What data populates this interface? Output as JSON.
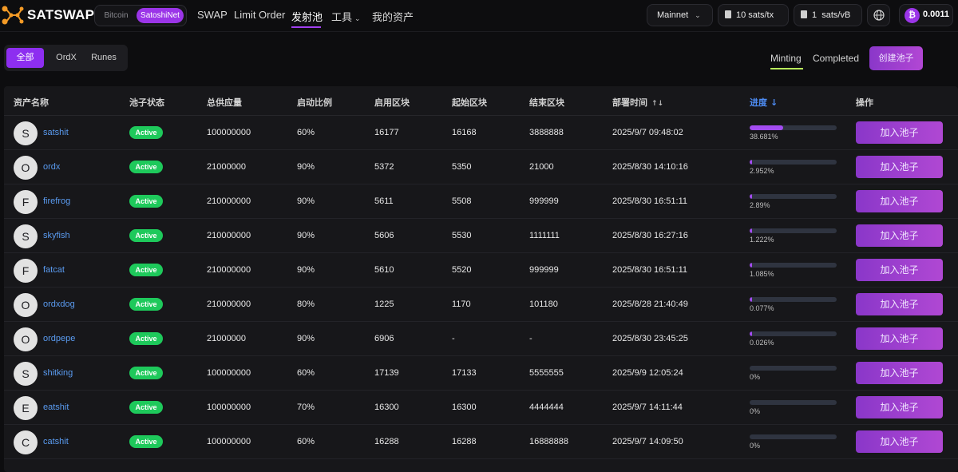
{
  "brand": {
    "name": "SATSWAP",
    "accent": "#9b35e8"
  },
  "network_toggle": {
    "bitcoin": "Bitcoin",
    "satoshinet": "SatoshiNet",
    "active": "SatoshiNet"
  },
  "nav": {
    "swap": "SWAP",
    "limit_order": "Limit Order",
    "launch_pool": "发射池",
    "tools": "工具",
    "my_assets": "我的资产",
    "active": "发射池"
  },
  "header_right": {
    "network": "Mainnet",
    "fee_tx": "10 sats/tx",
    "fee_vb": "1  sats/vB",
    "globe_icon": "globe-icon",
    "wallet_balance": "0.0011",
    "btc_symbol": "₿"
  },
  "filters": {
    "all": "全部",
    "ordx": "OrdX",
    "runes": "Runes",
    "active": "全部"
  },
  "status_tabs": {
    "minting": "Minting",
    "completed": "Completed",
    "active": "Minting"
  },
  "create_pool": "创建池子",
  "table": {
    "headers": {
      "asset": "资产名称",
      "status": "池子状态",
      "supply": "总供应量",
      "ratio": "启动比例",
      "enable_block": "启用区块",
      "start_block": "起始区块",
      "end_block": "结束区块",
      "deploy_time": "部署时间",
      "progress": "进度",
      "actions": "操作"
    },
    "join_label": "加入池子",
    "rows": [
      {
        "initial": "S",
        "name": "satshit",
        "status": "Active",
        "supply": "100000000",
        "ratio": "60%",
        "enable_block": "16177",
        "start_block": "16168",
        "end_block": "3888888",
        "deploy_time": "2025/9/7 09:48:02",
        "progress": 38.681,
        "progress_text": "38.681%"
      },
      {
        "initial": "O",
        "name": "ordx",
        "status": "Active",
        "supply": "21000000",
        "ratio": "90%",
        "enable_block": "5372",
        "start_block": "5350",
        "end_block": "21000",
        "deploy_time": "2025/8/30 14:10:16",
        "progress": 2.952,
        "progress_text": "2.952%"
      },
      {
        "initial": "F",
        "name": "firefrog",
        "status": "Active",
        "supply": "210000000",
        "ratio": "90%",
        "enable_block": "5611",
        "start_block": "5508",
        "end_block": "999999",
        "deploy_time": "2025/8/30 16:51:11",
        "progress": 2.89,
        "progress_text": "2.89%"
      },
      {
        "initial": "S",
        "name": "skyfish",
        "status": "Active",
        "supply": "210000000",
        "ratio": "90%",
        "enable_block": "5606",
        "start_block": "5530",
        "end_block": "1111111",
        "deploy_time": "2025/8/30 16:27:16",
        "progress": 1.222,
        "progress_text": "1.222%"
      },
      {
        "initial": "F",
        "name": "fatcat",
        "status": "Active",
        "supply": "210000000",
        "ratio": "90%",
        "enable_block": "5610",
        "start_block": "5520",
        "end_block": "999999",
        "deploy_time": "2025/8/30 16:51:11",
        "progress": 1.085,
        "progress_text": "1.085%"
      },
      {
        "initial": "O",
        "name": "ordxdog",
        "status": "Active",
        "supply": "210000000",
        "ratio": "80%",
        "enable_block": "1225",
        "start_block": "1170",
        "end_block": "101180",
        "deploy_time": "2025/8/28 21:40:49",
        "progress": 0.077,
        "progress_text": "0.077%"
      },
      {
        "initial": "O",
        "name": "ordpepe",
        "status": "Active",
        "supply": "21000000",
        "ratio": "90%",
        "enable_block": "6906",
        "start_block": "-",
        "end_block": "-",
        "deploy_time": "2025/8/30 23:45:25",
        "progress": 0.026,
        "progress_text": "0.026%"
      },
      {
        "initial": "S",
        "name": "shitking",
        "status": "Active",
        "supply": "100000000",
        "ratio": "60%",
        "enable_block": "17139",
        "start_block": "17133",
        "end_block": "5555555",
        "deploy_time": "2025/9/9 12:05:24",
        "progress": 0,
        "progress_text": "0%"
      },
      {
        "initial": "E",
        "name": "eatshit",
        "status": "Active",
        "supply": "100000000",
        "ratio": "70%",
        "enable_block": "16300",
        "start_block": "16300",
        "end_block": "4444444",
        "deploy_time": "2025/9/7 14:11:44",
        "progress": 0,
        "progress_text": "0%"
      },
      {
        "initial": "C",
        "name": "catshit",
        "status": "Active",
        "supply": "100000000",
        "ratio": "60%",
        "enable_block": "16288",
        "start_block": "16288",
        "end_block": "16888888",
        "deploy_time": "2025/9/7 14:09:50",
        "progress": 0,
        "progress_text": "0%"
      }
    ]
  }
}
